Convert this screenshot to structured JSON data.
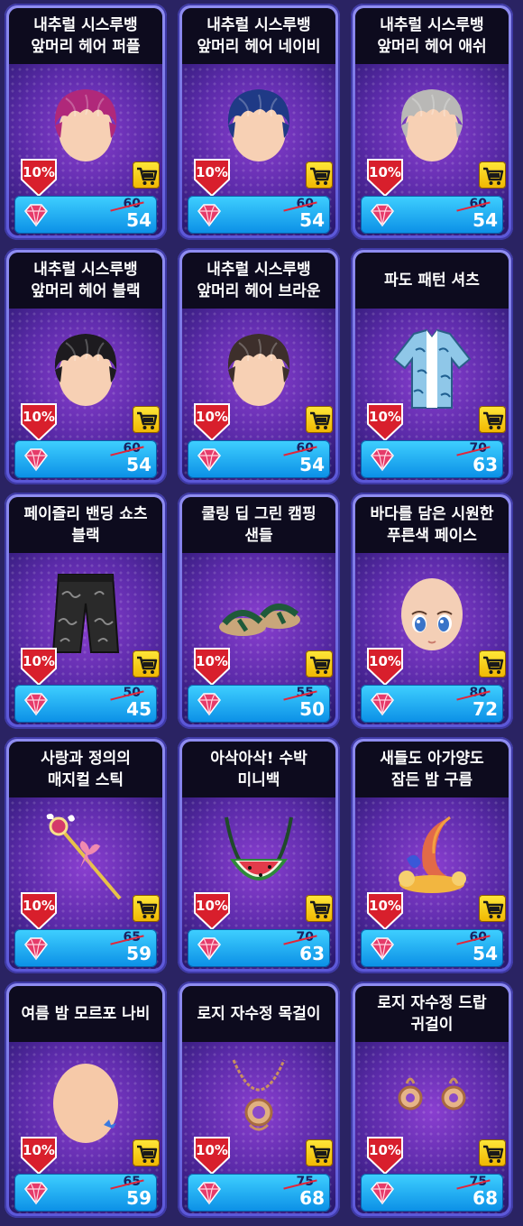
{
  "items": [
    {
      "title": "내추럴 시스루뱅\n앞머리 헤어 퍼플",
      "type": "hair",
      "color": "#b0287a",
      "discount": "10%",
      "old_price": "60",
      "new_price": "54"
    },
    {
      "title": "내추럴 시스루뱅\n앞머리 헤어 네이비",
      "type": "hair",
      "color": "#1f3a86",
      "discount": "10%",
      "old_price": "60",
      "new_price": "54"
    },
    {
      "title": "내추럴 시스루뱅\n앞머리 헤어 애쉬",
      "type": "hair",
      "color": "#b9b8b6",
      "discount": "10%",
      "old_price": "60",
      "new_price": "54"
    },
    {
      "title": "내추럴 시스루뱅\n앞머리 헤어 블랙",
      "type": "hair",
      "color": "#1d1b1f",
      "discount": "10%",
      "old_price": "60",
      "new_price": "54"
    },
    {
      "title": "내추럴 시스루뱅\n앞머리 헤어 브라운",
      "type": "hair",
      "color": "#3d2f2b",
      "discount": "10%",
      "old_price": "60",
      "new_price": "54"
    },
    {
      "title": "파도 패턴 셔츠",
      "type": "shirt",
      "color": "#8fc7e8",
      "discount": "10%",
      "old_price": "70",
      "new_price": "63"
    },
    {
      "title": "페이즐리 밴딩 쇼츠\n블랙",
      "type": "shorts",
      "color": "#2a2a2a",
      "discount": "10%",
      "old_price": "50",
      "new_price": "45"
    },
    {
      "title": "쿨링 딥 그린 캠핑\n샌들",
      "type": "sandals",
      "color": "#1f5a3a",
      "discount": "10%",
      "old_price": "55",
      "new_price": "50"
    },
    {
      "title": "바다를 담은 시원한\n푸른색 페이스",
      "type": "face",
      "color": "#f4cfb6",
      "discount": "10%",
      "old_price": "80",
      "new_price": "72"
    },
    {
      "title": "사랑과 정의의\n매지컬 스틱",
      "type": "wand",
      "color": "#d43a6a",
      "discount": "10%",
      "old_price": "65",
      "new_price": "59"
    },
    {
      "title": "아삭아삭! 수박\n미니백",
      "type": "bag",
      "color": "#2e8a3a",
      "discount": "10%",
      "old_price": "70",
      "new_price": "63"
    },
    {
      "title": "새들도 아가양도\n잠든 밤 구름",
      "type": "cloud",
      "color": "#f2b640",
      "discount": "10%",
      "old_price": "60",
      "new_price": "54"
    },
    {
      "title": "여름 밤 모르포 나비",
      "type": "baldface",
      "color": "#f6c9a8",
      "discount": "10%",
      "old_price": "65",
      "new_price": "59"
    },
    {
      "title": "로지 자수정 목걸이",
      "type": "necklace",
      "color": "#c99060",
      "discount": "10%",
      "old_price": "75",
      "new_price": "68"
    },
    {
      "title": "로지 자수정 드랍\n귀걸이",
      "type": "earrings",
      "color": "#c99060",
      "discount": "10%",
      "old_price": "75",
      "new_price": "68"
    }
  ],
  "icons": {
    "cart": "shopping-cart-icon",
    "currency": "ruby-gem-icon",
    "discount": "discount-arrow-badge"
  },
  "colors": {
    "price_bar": "#1aa6f0",
    "discount_badge": "#d81f2c",
    "cart": "#f5c400"
  }
}
